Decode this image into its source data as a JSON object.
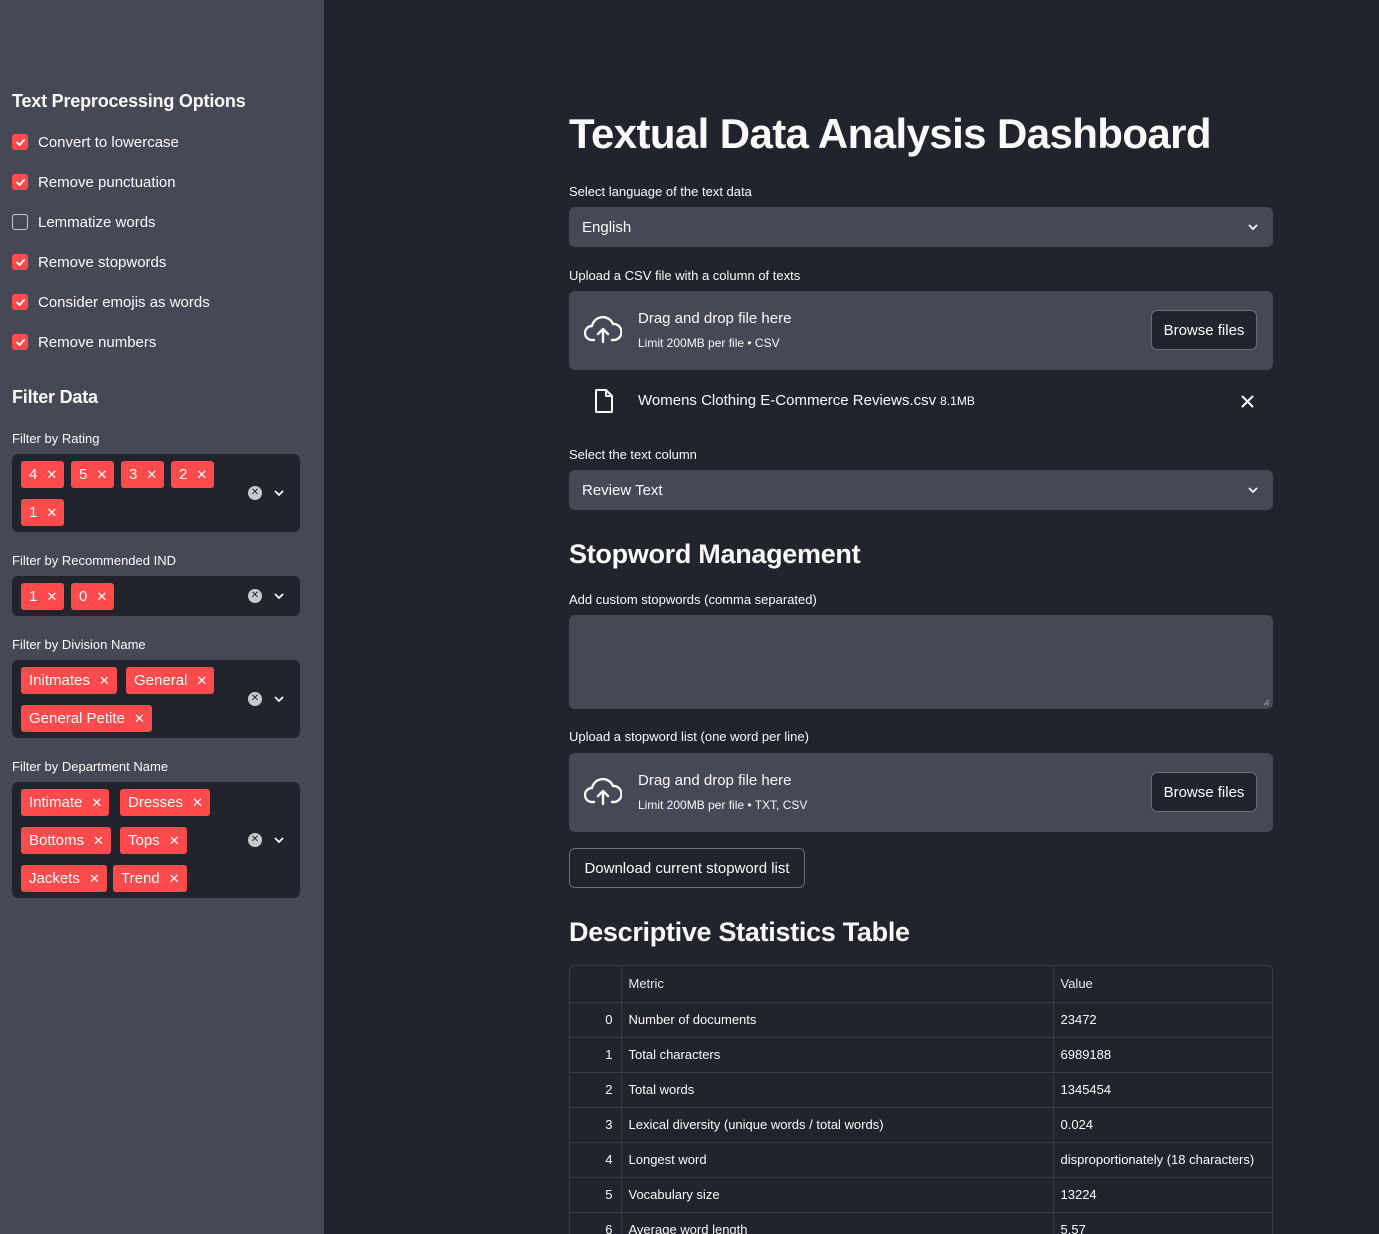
{
  "sidebar": {
    "preprocessing_heading": "Text Preprocessing Options",
    "options": [
      {
        "label": "Convert to lowercase",
        "checked": true
      },
      {
        "label": "Remove punctuation",
        "checked": true
      },
      {
        "label": "Lemmatize words",
        "checked": false
      },
      {
        "label": "Remove stopwords",
        "checked": true
      },
      {
        "label": "Consider emojis as words",
        "checked": true
      },
      {
        "label": "Remove numbers",
        "checked": true
      }
    ],
    "filter_heading": "Filter Data",
    "filters": {
      "rating": {
        "label": "Filter by Rating",
        "chips": [
          "4",
          "5",
          "3",
          "2",
          "1"
        ]
      },
      "recommended": {
        "label": "Filter by Recommended IND",
        "chips": [
          "1",
          "0"
        ]
      },
      "division": {
        "label": "Filter by Division Name",
        "chips": [
          "Initmates",
          "General",
          "General Petite"
        ]
      },
      "department": {
        "label": "Filter by Department Name",
        "chips": [
          "Intimate",
          "Dresses",
          "Bottoms",
          "Tops",
          "Jackets",
          "Trend"
        ]
      }
    }
  },
  "main": {
    "title": "Textual Data Analysis Dashboard",
    "language": {
      "label": "Select language of the text data",
      "value": "English"
    },
    "csv_upload": {
      "label": "Upload a CSV file with a column of texts",
      "drop_text": "Drag and drop file here",
      "limit_text": "Limit 200MB per file • CSV",
      "browse_label": "Browse files"
    },
    "uploaded_file": {
      "name": "Womens Clothing E-Commerce Reviews.csv",
      "size": "8.1MB"
    },
    "text_column": {
      "label": "Select the text column",
      "value": "Review Text"
    },
    "stopwords": {
      "heading": "Stopword Management",
      "custom_label": "Add custom stopwords (comma separated)",
      "custom_value": "",
      "list_upload": {
        "label": "Upload a stopword list (one word per line)",
        "drop_text": "Drag and drop file here",
        "limit_text": "Limit 200MB per file • TXT, CSV",
        "browse_label": "Browse files"
      },
      "download_label": "Download current stopword list"
    },
    "stats": {
      "heading": "Descriptive Statistics Table",
      "columns": [
        "",
        "Metric",
        "Value"
      ],
      "rows": [
        [
          "0",
          "Number of documents",
          "23472"
        ],
        [
          "1",
          "Total characters",
          "6989188"
        ],
        [
          "2",
          "Total words",
          "1345454"
        ],
        [
          "3",
          "Lexical diversity (unique words / total words)",
          "0.024"
        ],
        [
          "4",
          "Longest word",
          "disproportionately (18 characters)"
        ],
        [
          "5",
          "Vocabulary size",
          "13224"
        ],
        [
          "6",
          "Average word length",
          "5.57"
        ]
      ]
    }
  },
  "colors": {
    "accent": "#ff4b4b",
    "sidebar_bg": "#464855",
    "main_bg": "#21242d",
    "widget_bg": "#464855"
  }
}
